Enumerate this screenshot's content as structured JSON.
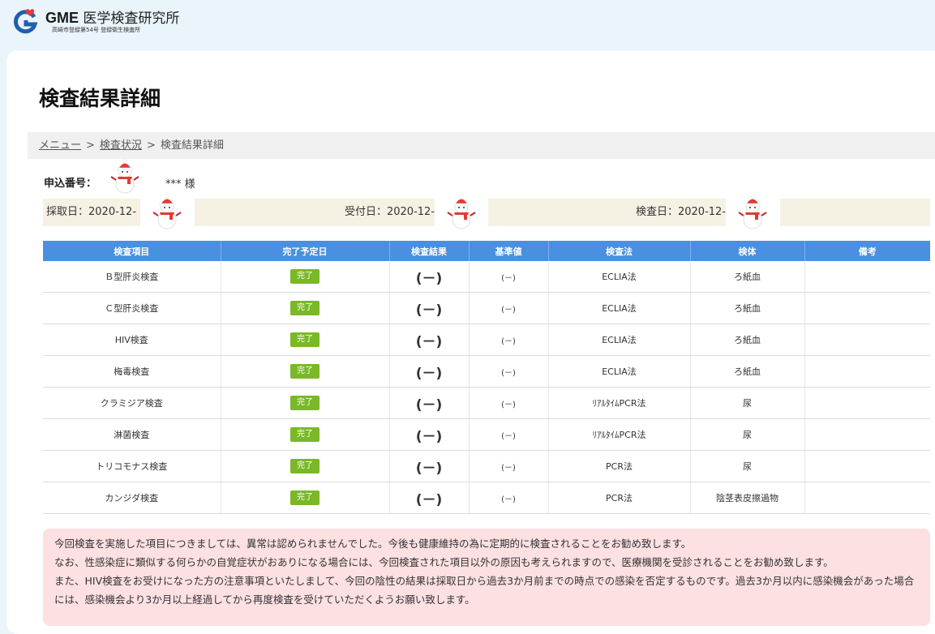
{
  "header": {
    "logo_brand": "GME",
    "logo_name": "医学検査研究所",
    "logo_subtitle": "高崎市登録第54号 登録衛生検査所"
  },
  "page": {
    "title": "検査結果詳細"
  },
  "breadcrumb": {
    "items": [
      {
        "label": "メニュー",
        "link": true
      },
      {
        "label": "検査状況",
        "link": true
      },
      {
        "label": "検査結果詳細",
        "link": false
      }
    ],
    "separator": ">"
  },
  "applicant": {
    "label": "申込番号：",
    "name": "*** 様"
  },
  "dates": {
    "collection": "採取日：2020-12-",
    "received": "受付日：2020-12-",
    "test": "検査日：2020-12-"
  },
  "table": {
    "headers": [
      "検査項目",
      "完了予定日",
      "検査結果",
      "基準値",
      "検査法",
      "検体",
      "備考"
    ],
    "rows": [
      {
        "item": "Ｂ型肝炎検査",
        "status": "完了",
        "result": "(－)",
        "ref": "(－)",
        "method": "ECLIA法",
        "specimen": "ろ紙血",
        "note": ""
      },
      {
        "item": "Ｃ型肝炎検査",
        "status": "完了",
        "result": "(－)",
        "ref": "(－)",
        "method": "ECLIA法",
        "specimen": "ろ紙血",
        "note": ""
      },
      {
        "item": "HIV検査",
        "status": "完了",
        "result": "(－)",
        "ref": "(－)",
        "method": "ECLIA法",
        "specimen": "ろ紙血",
        "note": ""
      },
      {
        "item": "梅毒検査",
        "status": "完了",
        "result": "(－)",
        "ref": "(－)",
        "method": "ECLIA法",
        "specimen": "ろ紙血",
        "note": ""
      },
      {
        "item": "クラミジア検査",
        "status": "完了",
        "result": "(－)",
        "ref": "(－)",
        "method": "ﾘｱﾙﾀｲﾑPCR法",
        "specimen": "尿",
        "note": ""
      },
      {
        "item": "淋菌検査",
        "status": "完了",
        "result": "(－)",
        "ref": "(－)",
        "method": "ﾘｱﾙﾀｲﾑPCR法",
        "specimen": "尿",
        "note": ""
      },
      {
        "item": "トリコモナス検査",
        "status": "完了",
        "result": "(－)",
        "ref": "(－)",
        "method": "PCR法",
        "specimen": "尿",
        "note": ""
      },
      {
        "item": "カンジダ検査",
        "status": "完了",
        "result": "(－)",
        "ref": "(－)",
        "method": "PCR法",
        "specimen": "陰茎表皮擦過物",
        "note": ""
      }
    ]
  },
  "notice": {
    "lines": [
      "今回検査を実施した項目につきましては、異常は認められませんでした。今後も健康維持の為に定期的に検査されることをお勧め致します。",
      "なお、性感染症に類似する何らかの自覚症状がおありになる場合には、今回検査された項目以外の原因も考えられますので、医療機関を受診されることをお勧め致します。",
      "また、HIV検査をお受けになった方の注意事項といたしまして、今回の陰性の結果は採取日から過去3か月前までの時点での感染を否定するものです。過去3か月以内に感染機会があった場合には、感染機会より3か月以上経過してから再度検査を受けていただくようお願い致します。"
    ]
  },
  "colors": {
    "table_header": "#4a8fe0",
    "badge": "#7ab827",
    "notice_bg": "#fde0e2",
    "date_bar": "#f5f2e4",
    "logo_red": "#e8383d",
    "logo_blue": "#1f5fae"
  }
}
